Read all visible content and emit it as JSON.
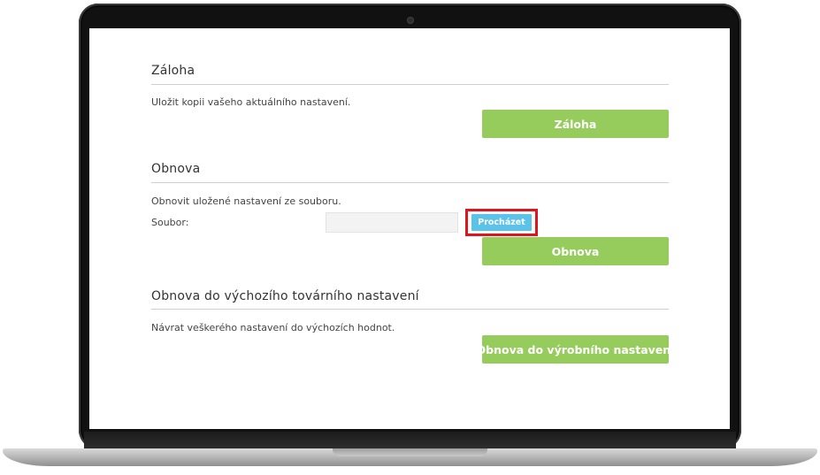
{
  "backup": {
    "title": "Záloha",
    "description": "Uložit kopii vašeho aktuálního nastavení.",
    "button_label": "Záloha"
  },
  "restore": {
    "title": "Obnova",
    "description": "Obnovit uložené nastavení ze souboru.",
    "file_label": "Soubor:",
    "file_value": "",
    "browse_label": "Procházet",
    "button_label": "Obnova"
  },
  "factory": {
    "title": "Obnova do výchozího továrního nastavení",
    "description": "Návrat veškerého nastavení do výchozích hodnot.",
    "button_label": "Obnova do výrobního nastavení"
  },
  "colors": {
    "primary_button": "#95cc5c",
    "browse_button": "#5bc3ea",
    "highlight_border": "#e0141e"
  }
}
